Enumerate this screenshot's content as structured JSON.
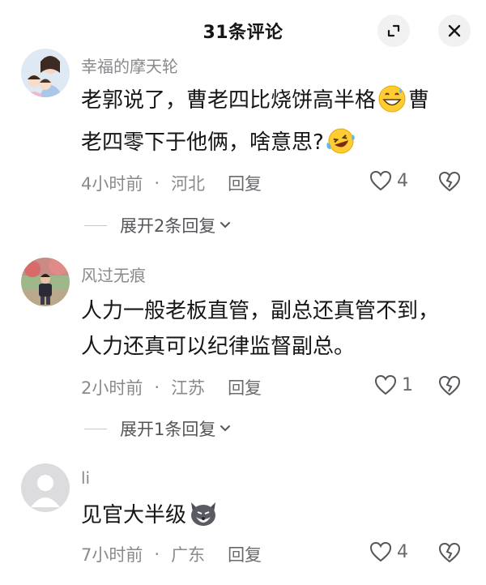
{
  "header": {
    "title": "31条评论"
  },
  "comments": [
    {
      "username": "幸福的摩天轮",
      "text_part1": "老郭说了，曹老四比烧饼高半格",
      "text_part2": "曹",
      "text_part3": "老四零下于他俩，啥意思?",
      "emojis": [
        "grinning-sweat-emoji",
        "laughing-tears-emoji"
      ],
      "time": "4小时前",
      "location": "河北",
      "reply_label": "回复",
      "likes": "4",
      "expand_label": "展开2条回复"
    },
    {
      "username": "风过无痕",
      "text_line1": "人力一般老板直管，副总还真管不到，",
      "text_line2": "人力还真可以纪律监督副总。",
      "time": "2小时前",
      "location": "江苏",
      "reply_label": "回复",
      "likes": "1",
      "expand_label": "展开1条回复"
    },
    {
      "username": "li",
      "text": "见官大半级",
      "emojis": [
        "dog-face-emoji"
      ],
      "time": "7小时前",
      "location": "广东",
      "reply_label": "回复",
      "likes": "4"
    }
  ],
  "dot_separator": "·"
}
